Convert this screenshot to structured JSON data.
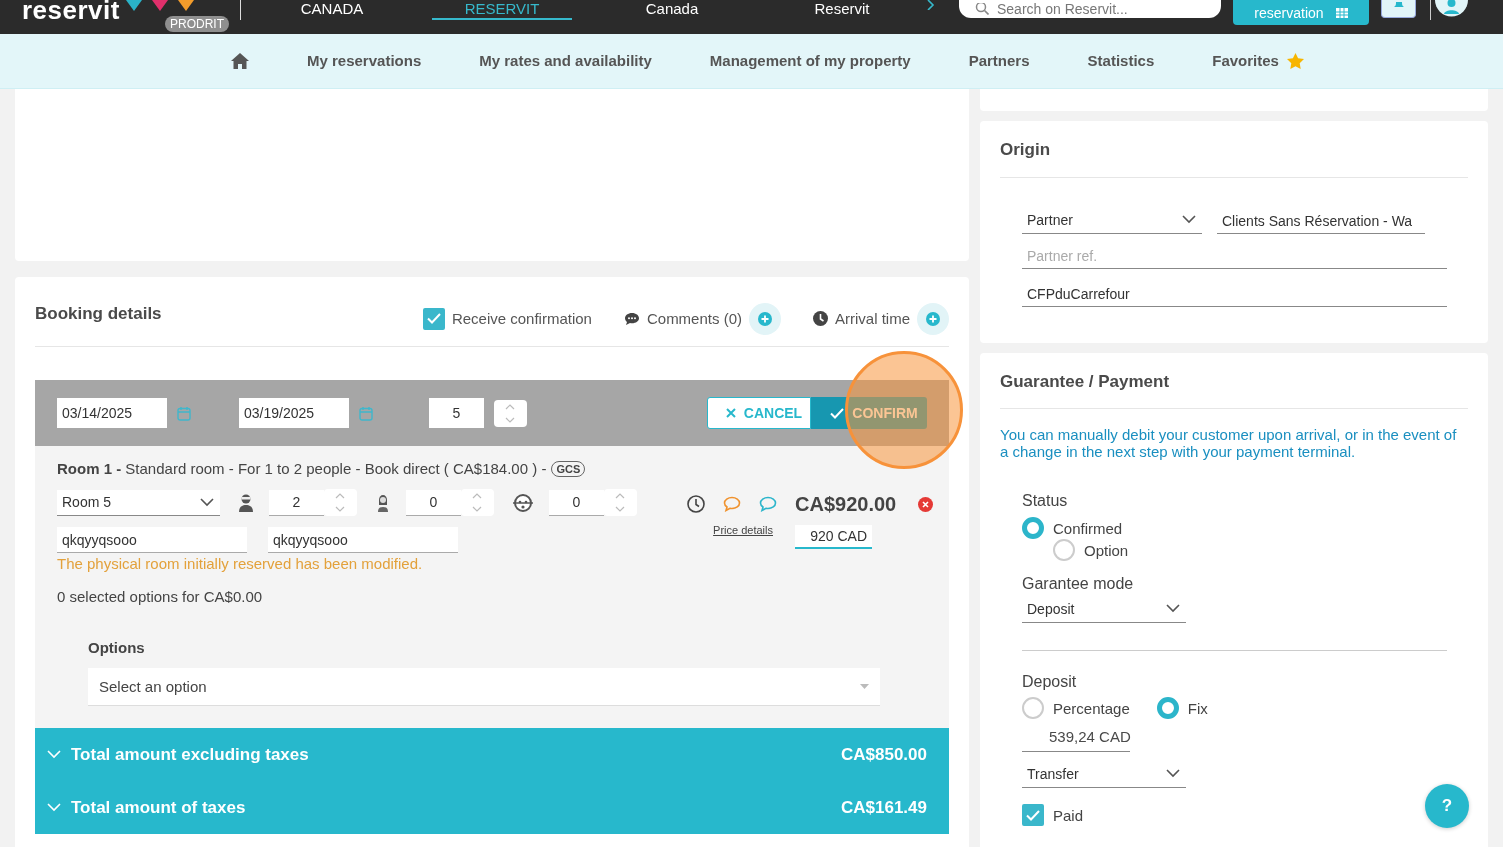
{
  "header": {
    "logo": "reservit",
    "badge": "PRODRIT",
    "links": [
      {
        "label": "CANADA",
        "selected": false
      },
      {
        "label": "RESERVIT",
        "selected": true
      },
      {
        "label": "Canada",
        "selected": false
      },
      {
        "label": "Reservit",
        "selected": false
      }
    ],
    "search": {
      "placeholder": "Search on Reservit..."
    },
    "new_button": "reservation"
  },
  "nav": {
    "items": [
      {
        "label": "My reservations"
      },
      {
        "label": "My rates and availability"
      },
      {
        "label": "Management of my property"
      },
      {
        "label": "Partners"
      },
      {
        "label": "Statistics"
      },
      {
        "label": "Favorites"
      }
    ]
  },
  "booking": {
    "title": "Booking details",
    "receive_confirmation": {
      "label": "Receive confirmation",
      "checked": true
    },
    "comments": "Comments (0)",
    "arrival_time": "Arrival time",
    "arrival": "03/14/2025",
    "departure": "03/19/2025",
    "nights": "5",
    "cancel": "CANCEL",
    "confirm": "CONFIRM",
    "room": {
      "title": "**Room 1 -** Standard room - For 1 to 2 people - Book direct ( CA$184.00 ) -",
      "tag": "GCS",
      "room_select": "Room 5",
      "adults": "2",
      "children": "0",
      "babies": "0",
      "price": "CA$920.00",
      "price_link": "Price details",
      "price_input": "920 CAD",
      "guest_first": "qkqyyqsooo",
      "guest_last": "qkqyyqsooo",
      "warning": "The physical room initially reserved has been modified.",
      "options_summary": "0 selected options for CA$0.00",
      "options_label": "Options",
      "options_placeholder": "Select an option"
    },
    "totals": [
      {
        "label": "Total amount excluding taxes",
        "value": "CA$850.00"
      },
      {
        "label": "Total amount of taxes",
        "value": "CA$161.49"
      }
    ]
  },
  "origin": {
    "title": "Origin",
    "source_select": "Partner",
    "partner_name": "Clients Sans Réservation - Wa",
    "partner_ref": {
      "placeholder": "Partner ref."
    },
    "reference": "CFPduCarrefour"
  },
  "guarantee": {
    "title": "Guarantee / Payment",
    "info": "You can manually debit your customer upon arrival, or in the event of a change in the next step with your payment terminal.",
    "status_label": "Status",
    "status_options": [
      {
        "label": "Confirmed",
        "selected": true
      },
      {
        "label": "Option",
        "selected": false
      }
    ],
    "mode_label": "Garantee mode",
    "mode_select": "Deposit",
    "deposit_label": "Deposit",
    "deposit_types": [
      {
        "label": "Percentage",
        "selected": false
      },
      {
        "label": "Fix",
        "selected": true
      }
    ],
    "amount": "539,24 CAD",
    "method_select": "Transfer",
    "paid": {
      "label": "Paid",
      "checked": true
    }
  },
  "help": "?"
}
